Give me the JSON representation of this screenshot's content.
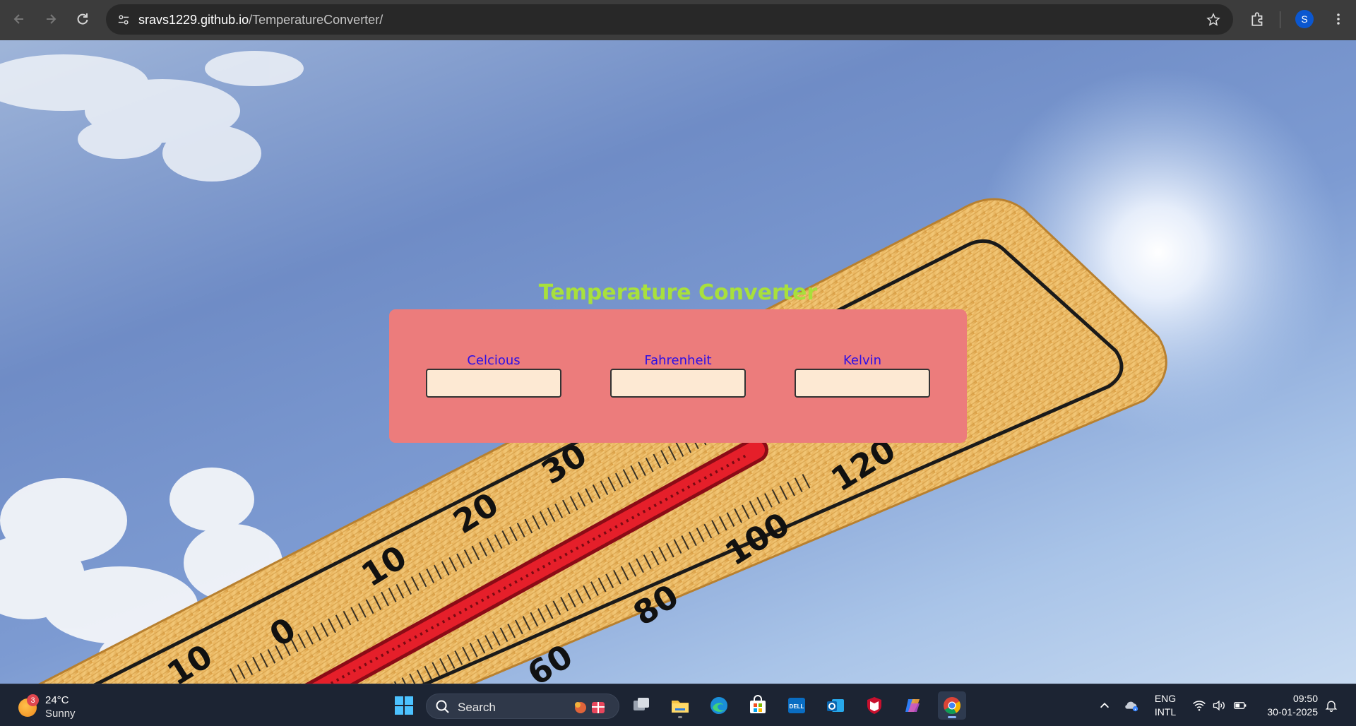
{
  "browser": {
    "url_host": "sravs1229.github.io",
    "url_path": "/TemperatureConverter/",
    "profile_initial": "S"
  },
  "page": {
    "title": "Temperature Converter",
    "fields": [
      {
        "label": "Celcious",
        "value": ""
      },
      {
        "label": "Fahrenheit",
        "value": ""
      },
      {
        "label": "Kelvin",
        "value": ""
      }
    ],
    "colors": {
      "title": "#a8e03c",
      "card": "#ec7c7c",
      "label": "#2b0fe6",
      "input_bg": "#fde9d3"
    }
  },
  "thermometer": {
    "scale_labels": [
      "120",
      "100",
      "80",
      "60",
      "30",
      "20",
      "10",
      "0",
      "10"
    ]
  },
  "taskbar": {
    "weather": {
      "badge": "3",
      "temp": "24°C",
      "condition": "Sunny"
    },
    "search_label": "Search",
    "apps": [
      "windows-start",
      "search",
      "task-view",
      "file-explorer",
      "edge",
      "microsoft-store",
      "dell",
      "outlook",
      "mcafee",
      "copilot",
      "chrome"
    ],
    "language": {
      "line1": "ENG",
      "line2": "INTL"
    },
    "clock": {
      "time": "09:50",
      "date": "30-01-2025"
    }
  }
}
